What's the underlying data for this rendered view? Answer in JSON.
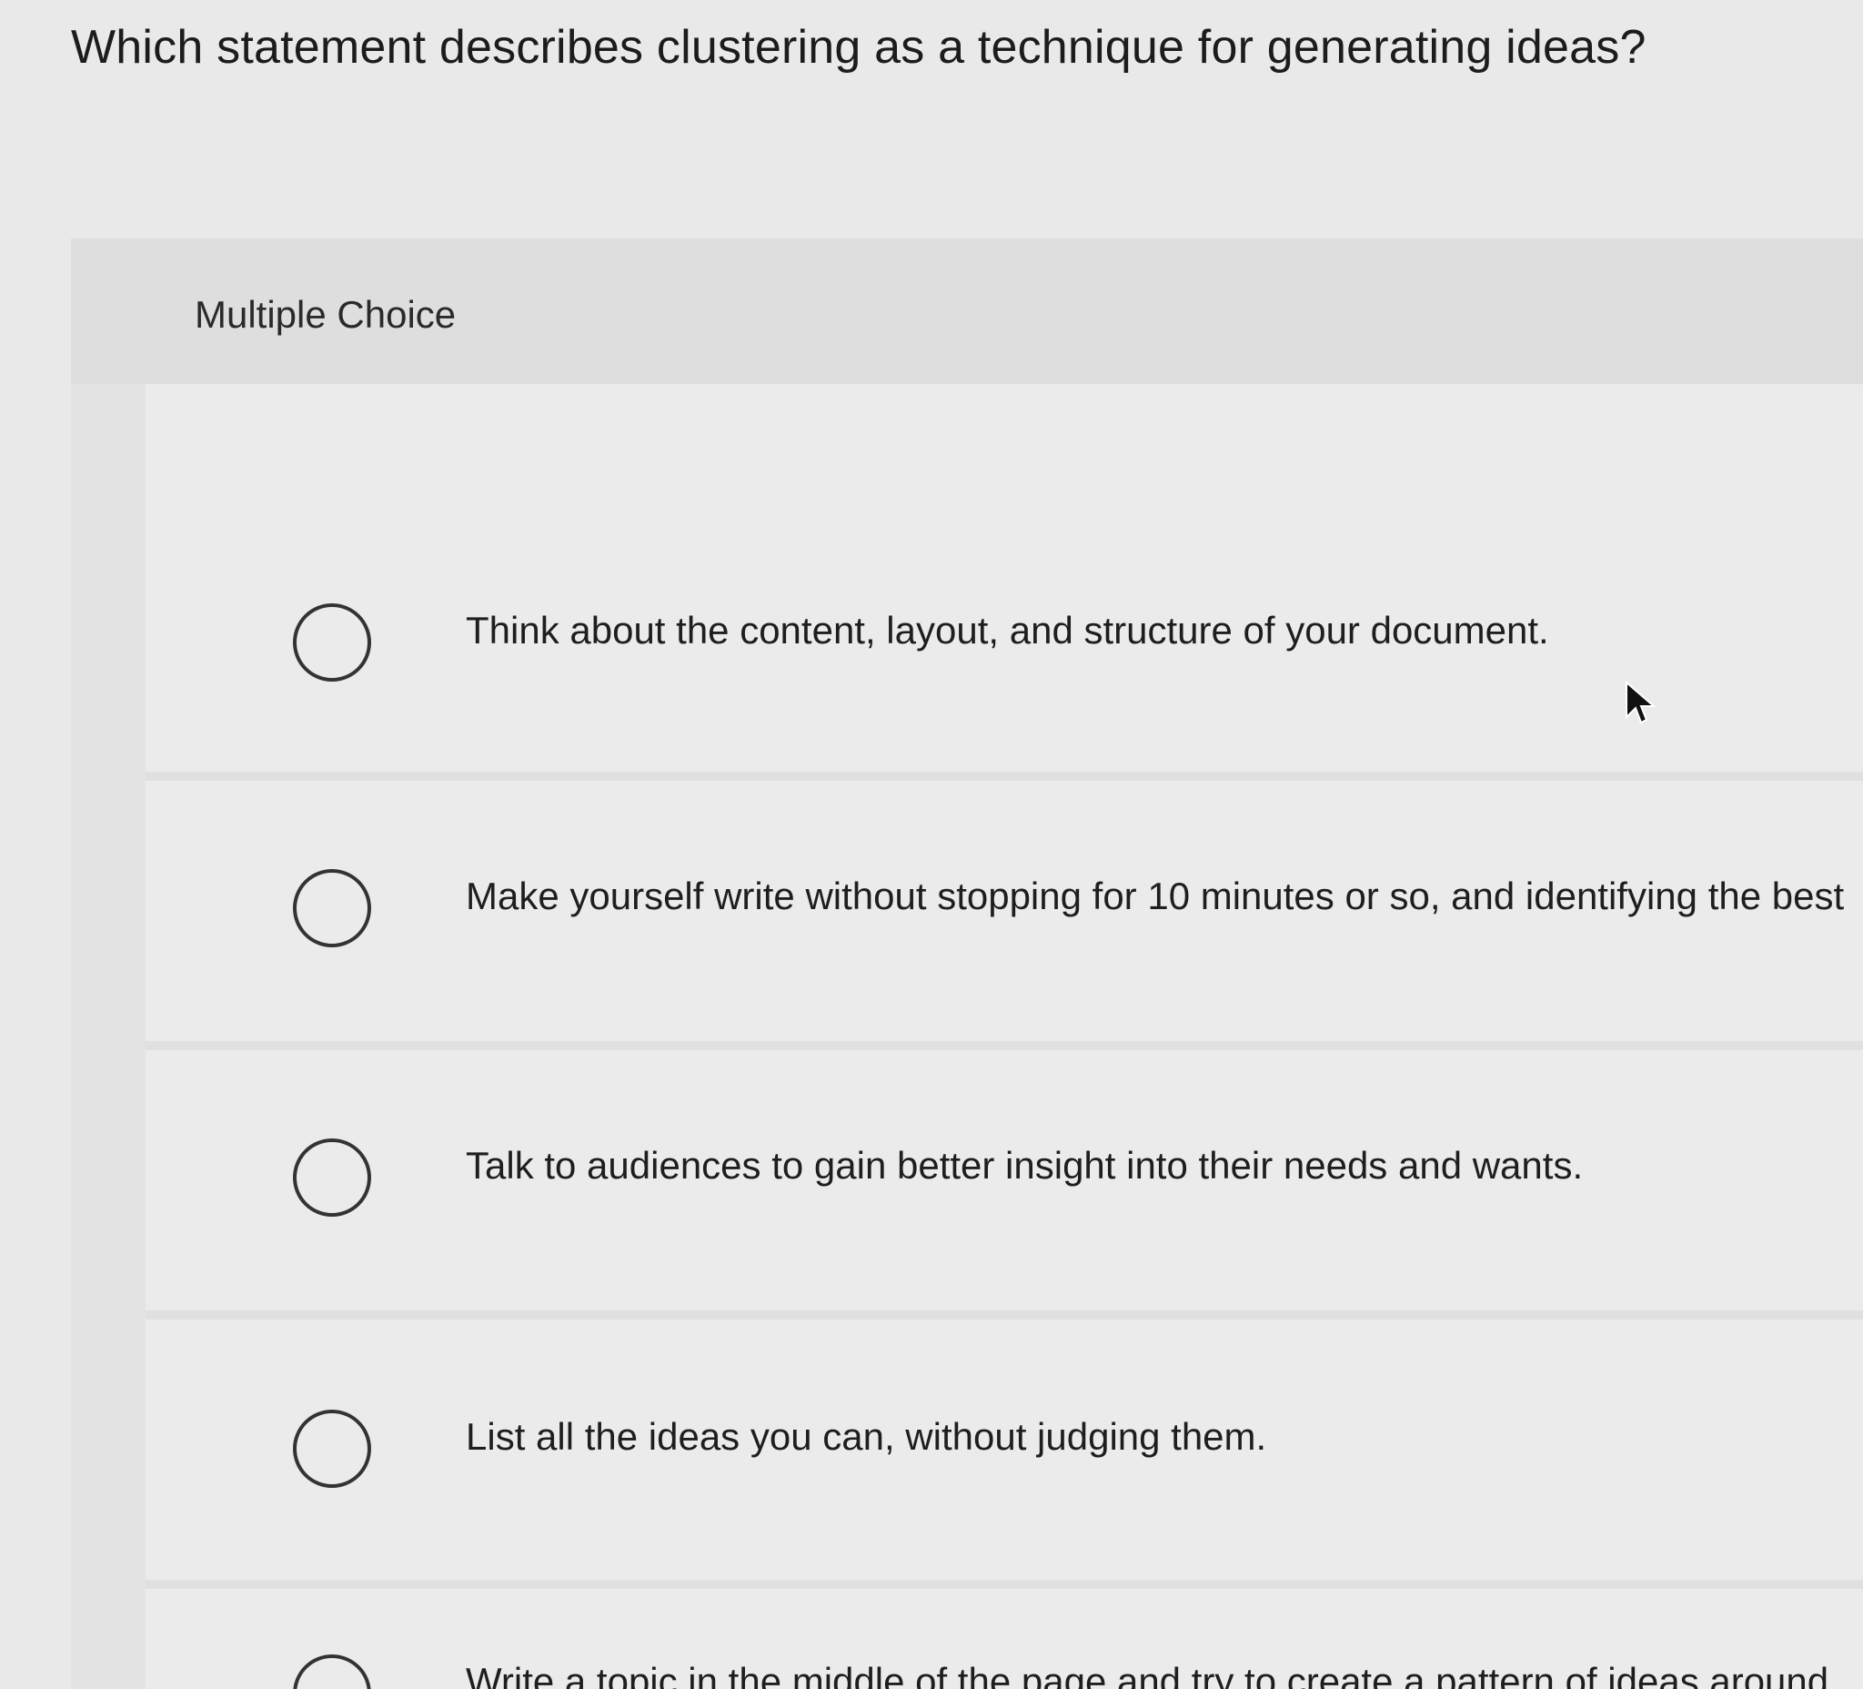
{
  "question": {
    "text": "Which statement describes clustering as a technique for generating ideas?"
  },
  "question_type": "Multiple Choice",
  "options": [
    {
      "label": "Think about the content, layout, and structure of your document."
    },
    {
      "label": "Make yourself write without stopping for 10 minutes or so, and identifying the best"
    },
    {
      "label": "Talk to audiences to gain better insight into their needs and wants."
    },
    {
      "label": "List all the ideas you can, without judging them."
    },
    {
      "label": "Write a topic in the middle of the page and try to create a pattern of ideas around"
    }
  ],
  "icons": {
    "cursor": "mouse-pointer-icon",
    "radio": "radio-button-unselected"
  }
}
